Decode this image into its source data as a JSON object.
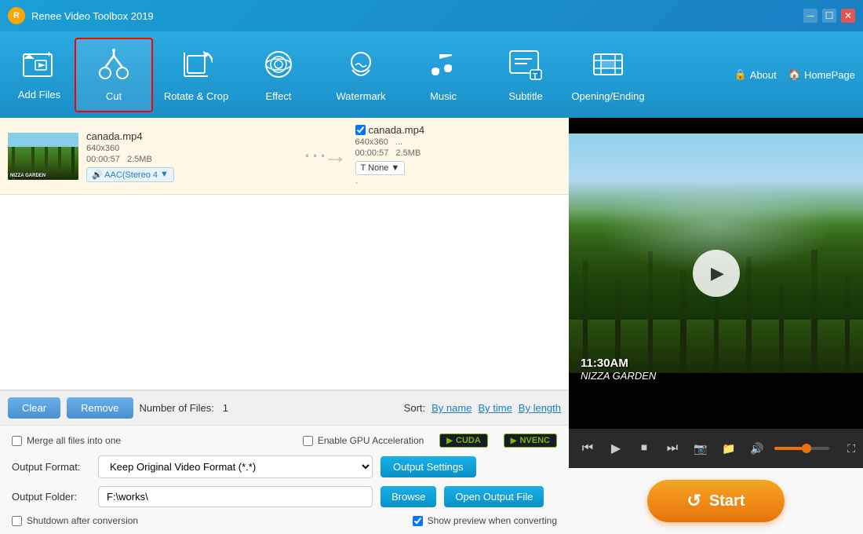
{
  "app": {
    "title": "Renee Video Toolbox 2019",
    "logo_char": "R"
  },
  "titlebar": {
    "controls": [
      "▾",
      "─",
      "☐",
      "✕"
    ]
  },
  "toolbar": {
    "items": [
      {
        "id": "add-files",
        "label": "Add Files",
        "icon": "🎬",
        "active": false
      },
      {
        "id": "cut",
        "label": "Cut",
        "icon": "✂",
        "active": true
      },
      {
        "id": "rotate-crop",
        "label": "Rotate & Crop",
        "icon": "⟲",
        "active": false
      },
      {
        "id": "effect",
        "label": "Effect",
        "icon": "🎡",
        "active": false
      },
      {
        "id": "watermark",
        "label": "Watermark",
        "icon": "💧",
        "active": false
      },
      {
        "id": "music",
        "label": "Music",
        "icon": "♪",
        "active": false
      },
      {
        "id": "subtitle",
        "label": "Subtitle",
        "icon": "💬",
        "active": false
      },
      {
        "id": "opening-ending",
        "label": "Opening/Ending",
        "icon": "📋",
        "active": false
      }
    ],
    "about": "About",
    "homepage": "HomePage"
  },
  "filelist": {
    "items": [
      {
        "thumbnail_text": "NIZZA GARDEN",
        "input_name": "canada.mp4",
        "input_resolution": "640x360",
        "input_duration": "00:00:57",
        "input_size": "2.5MB",
        "audio_label": "🔊 AAC(Stereo 4",
        "output_name": "canada.mp4",
        "output_resolution": "640x360",
        "output_more": "...",
        "output_duration": "00:00:57",
        "output_size": "2.5MB",
        "subtitle_label": "T  None",
        "output_dash": "-"
      }
    ]
  },
  "bottom_bar": {
    "clear_label": "Clear",
    "remove_label": "Remove",
    "file_count_prefix": "Number of Files:",
    "file_count": "1",
    "sort_label": "Sort:",
    "sort_options": [
      "By name",
      "By time",
      "By length"
    ]
  },
  "options": {
    "merge_label": "Merge all files into one",
    "gpu_label": "Enable GPU Acceleration",
    "cuda_label": "CUDA",
    "nvenc_label": "NVENC",
    "format_label": "Output Format:",
    "format_value": "Keep Original Video Format (*.*)",
    "output_settings_label": "Output Settings",
    "folder_label": "Output Folder:",
    "folder_value": "F:\\works\\",
    "browse_label": "Browse",
    "open_output_label": "Open Output File",
    "shutdown_label": "Shutdown after conversion",
    "show_preview_label": "Show preview when converting",
    "show_preview_checked": true
  },
  "video_preview": {
    "overlay_time": "11:30AM",
    "overlay_location": "NIZZA GARDEN",
    "play_icon": "▶"
  },
  "video_controls": {
    "skip_back": "⏮",
    "play": "▶",
    "stop": "⏹",
    "skip_fwd": "⏭",
    "screenshot": "📷",
    "folder": "📁",
    "volume_pct": 60
  },
  "start_button": {
    "icon": "↺",
    "label": "Start"
  }
}
